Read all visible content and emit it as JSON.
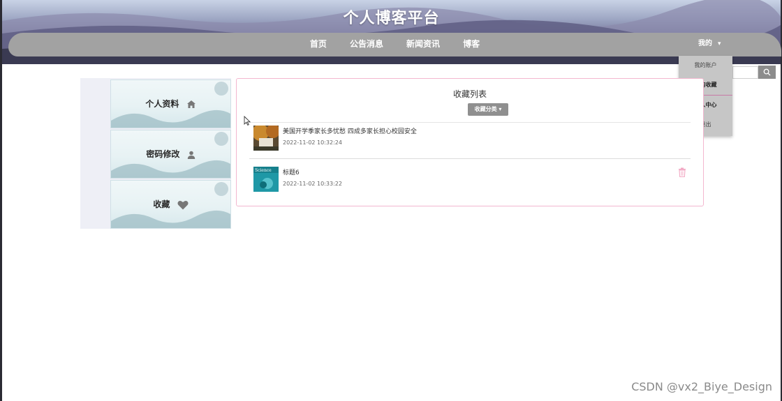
{
  "header": {
    "site_title": "个人博客平台",
    "nav_items": [
      "首页",
      "公告消息",
      "新闻资讯",
      "博客"
    ],
    "user_menu_label": "我的"
  },
  "dropdown": {
    "items": [
      "我的账户",
      "我的收藏",
      "个人中心",
      "退出"
    ]
  },
  "search": {
    "placeholder": "",
    "button_icon": "search-icon"
  },
  "sidebar": {
    "items": [
      {
        "label": "个人资料",
        "icon": "home-icon"
      },
      {
        "label": "密码修改",
        "icon": "user-icon"
      },
      {
        "label": "收藏",
        "icon": "heart-icon"
      }
    ]
  },
  "main": {
    "title": "收藏列表",
    "category_button": "收藏分类",
    "favorites": [
      {
        "title": "美国开学季家长多忧愁 四成多家长担心校园安全",
        "time": "2022-11-02 10:32:24",
        "thumb": "autumn-campus-image"
      },
      {
        "title": "标题6",
        "time": "2022-11-02 10:33:22",
        "thumb": "science-cover-image"
      }
    ],
    "delete_icon": "trash-icon"
  },
  "watermark": "CSDN @vx2_Biye_Design",
  "colors": {
    "navbar": "#a2a2a2",
    "panel_border": "#f3b7cf",
    "button_gray": "#8f8f8f"
  }
}
